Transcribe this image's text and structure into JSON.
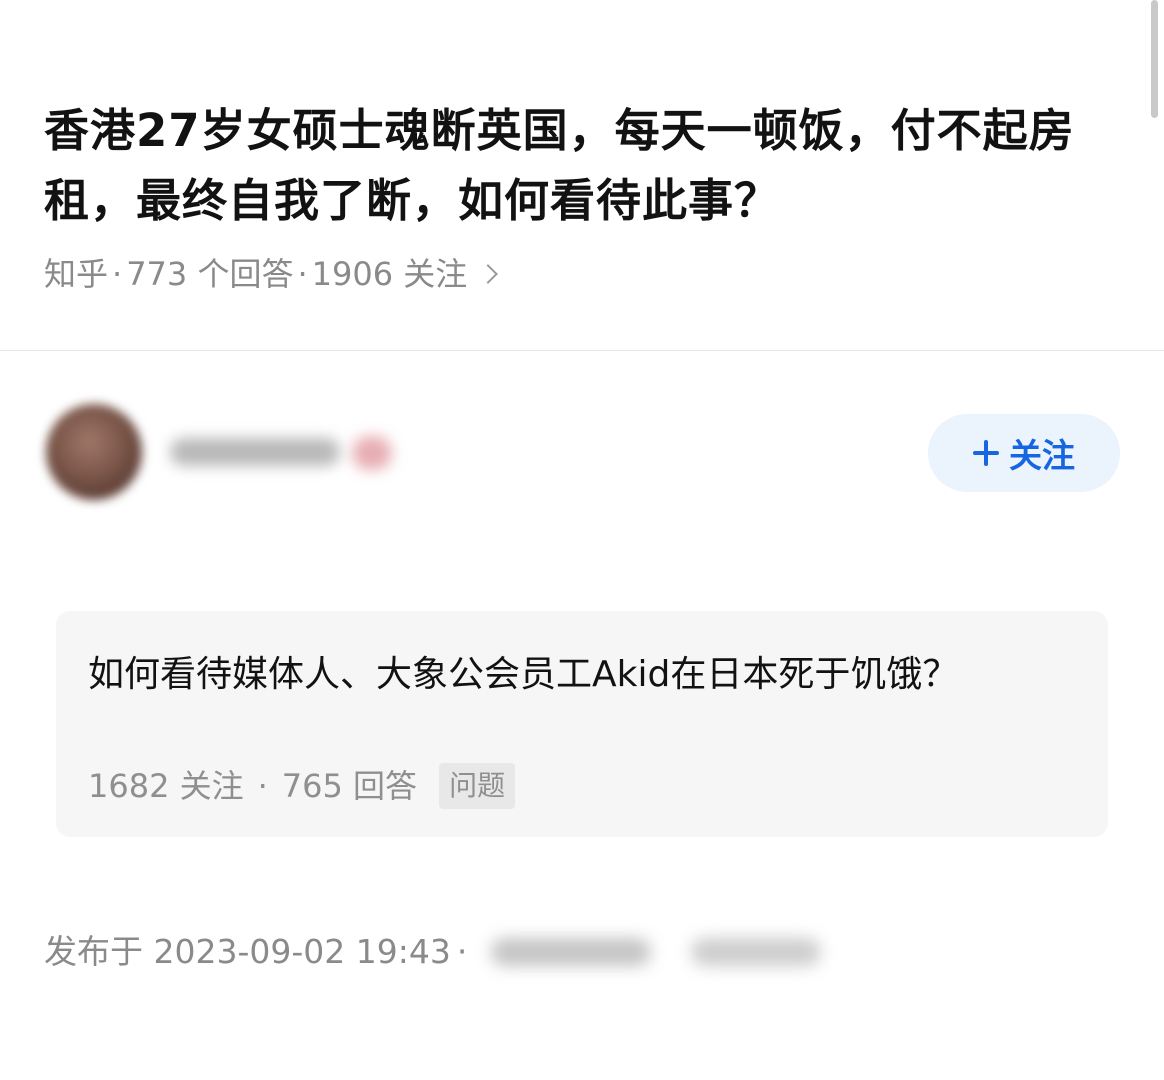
{
  "question": {
    "title": "香港27岁女硕士魂断英国，每天一顿饭，付不起房租，最终自我了断，如何看待此事？",
    "meta": {
      "source": "知乎",
      "answers": "773 个回答",
      "follows": "1906 关注",
      "separator": "·"
    }
  },
  "author": {
    "follow_label": "关注"
  },
  "related_question": {
    "title": "如何看待媒体人、大象公会员工Akid在日本死于饥饿？",
    "follows": "1682 关注",
    "answers": "765 回答",
    "separator": "·",
    "tag": "问题"
  },
  "answer_info": {
    "published": "发布于 2023-09-02 19:43",
    "separator": "·"
  },
  "icons": {
    "follow": "plus-icon",
    "more": "chevron-right-icon"
  },
  "colors": {
    "accent": "#1766e1",
    "follow_bg": "#ebf3fd",
    "meta_text": "#8a8a8a",
    "card_bg": "#f6f6f6"
  }
}
